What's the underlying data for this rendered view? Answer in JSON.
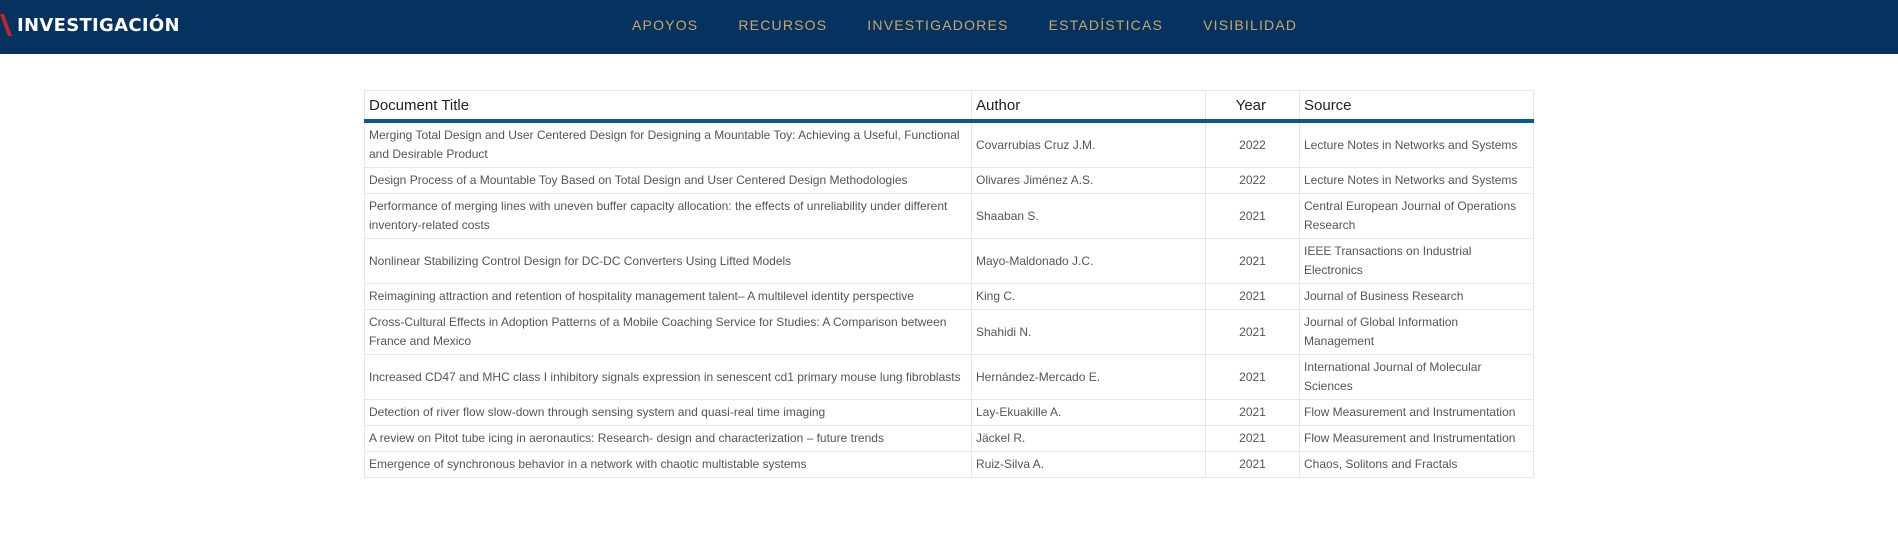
{
  "header": {
    "brand": "INVESTIGACIÓN",
    "nav": [
      "APOYOS",
      "RECURSOS",
      "INVESTIGADORES",
      "ESTADÍSTICAS",
      "VISIBILIDAD"
    ],
    "colors": {
      "bar": "#063260",
      "nav_text": "#c9a866",
      "accent": "#0b5a8e"
    }
  },
  "table": {
    "headers": [
      "Document Title",
      "Author",
      "Year",
      "Source"
    ],
    "rows": [
      [
        "Merging Total Design and User Centered Design for Designing a Mountable Toy: Achieving a Useful, Functional and Desirable Product",
        "Covarrubias Cruz J.M.",
        "2022",
        "Lecture Notes in Networks and Systems"
      ],
      [
        "Design Process of a Mountable Toy Based on Total Design and User Centered Design Methodologies",
        "Olivares Jiménez A.S.",
        "2022",
        "Lecture Notes in Networks and Systems"
      ],
      [
        "Performance of merging lines with uneven buffer capacity allocation: the effects of unreliability under different inventory-related costs",
        "Shaaban S.",
        "2021",
        "Central European Journal of Operations Research"
      ],
      [
        "Nonlinear Stabilizing Control Design for DC-DC Converters Using Lifted Models",
        "Mayo-Maldonado J.C.",
        "2021",
        "IEEE Transactions on Industrial Electronics"
      ],
      [
        "Reimagining attraction and retention of hospitality management talent– A multilevel identity perspective",
        "King C.",
        "2021",
        "Journal of Business Research"
      ],
      [
        "Cross-Cultural Effects in Adoption Patterns of a Mobile Coaching Service for Studies: A Comparison between France and Mexico",
        "Shahidi N.",
        "2021",
        "Journal of Global Information Management"
      ],
      [
        "Increased CD47 and MHC class I inhibitory signals expression in senescent cd1 primary mouse lung fibroblasts",
        "Hernández-Mercado E.",
        "2021",
        "International Journal of Molecular Sciences"
      ],
      [
        "Detection of river flow slow-down through sensing system and quasi-real time imaging",
        "Lay-Ekuakille A.",
        "2021",
        "Flow Measurement and Instrumentation"
      ],
      [
        "A review on Pitot tube icing in aeronautics: Research- design and characterization – future trends",
        "Jäckel R.",
        "2021",
        "Flow Measurement and Instrumentation"
      ],
      [
        "Emergence of synchronous behavior in a network with chaotic multistable systems",
        "Ruiz-Silva A.",
        "2021",
        "Chaos, Solitons and Fractals"
      ]
    ]
  }
}
